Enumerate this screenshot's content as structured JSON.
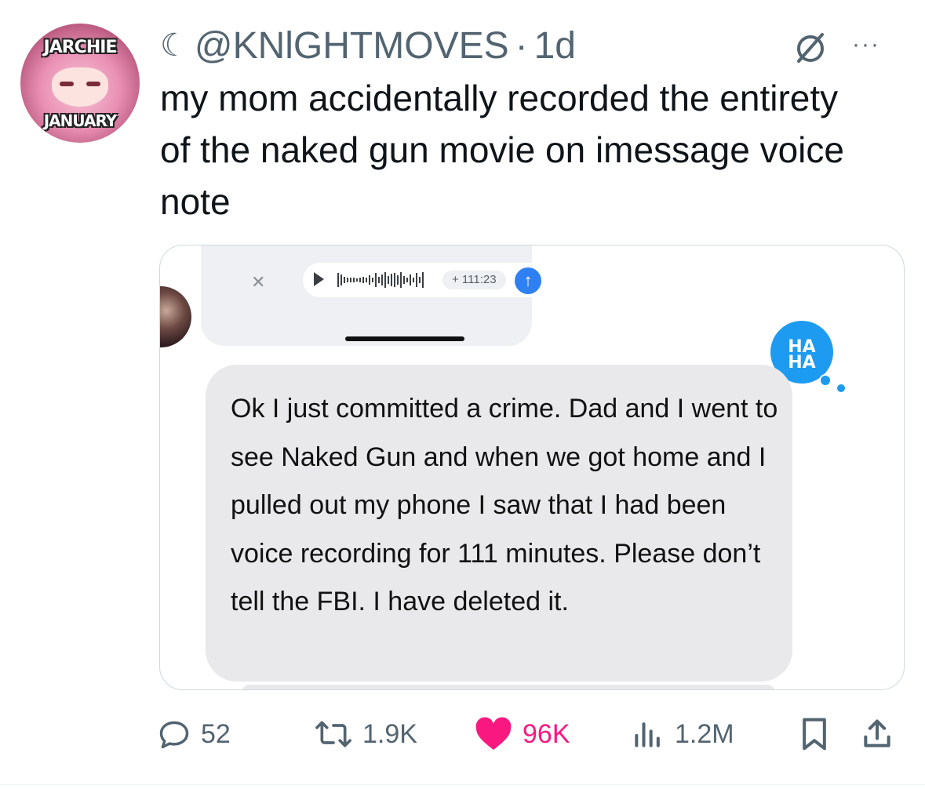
{
  "tweet": {
    "avatar_top_text": "JARCHIE",
    "avatar_bottom_text": "JANUARY",
    "moon_glyph": "☾",
    "handle": "@KNlGHTMOVES",
    "separator": "·",
    "time": "1d",
    "more_glyph": "···",
    "text": "my mom accidentally recorded the entirety of the naked gun movie on imessage voice note"
  },
  "media": {
    "close_glyph": "✕",
    "duration": "+ 111:23",
    "send_glyph": "↑",
    "reaction": {
      "line1": "HA",
      "line2": "HA",
      "color": "#1d9bf0"
    },
    "message": "Ok I just committed a crime. Dad and I went to see Naked Gun and when we got home and I pulled out my phone I saw that I had been voice recording for 111 minutes. Please don’t tell the FBI. I have deleted it."
  },
  "actions": {
    "replies": "52",
    "reposts": "1.9K",
    "likes": "96K",
    "views": "1.2M"
  },
  "colors": {
    "muted": "#536471",
    "like": "#f91880",
    "imessage_blue": "#2f80f2",
    "bubble_gray": "#e9e9eb"
  }
}
